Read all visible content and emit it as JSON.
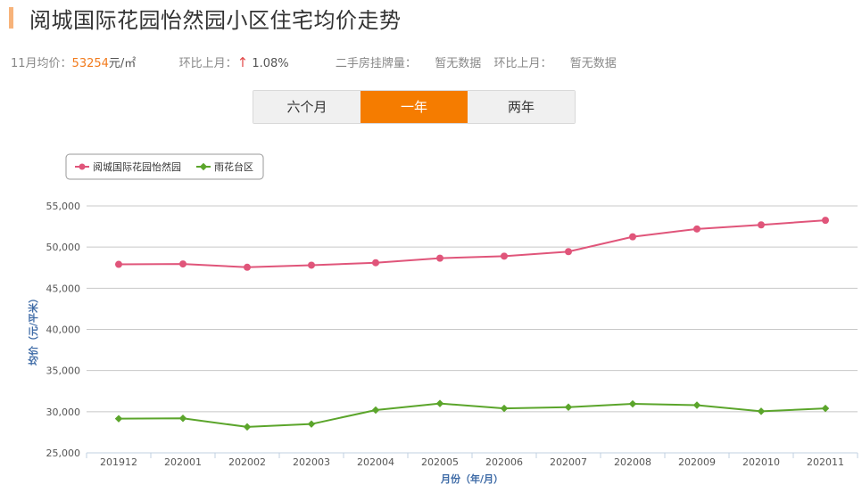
{
  "header": {
    "title": "阅城国际花园怡然园小区住宅均价走势"
  },
  "stats": {
    "avg_label": "11月均价：",
    "avg_value": "53254",
    "avg_unit": "元/㎡",
    "mom_label": "环比上月：",
    "mom_arrow": "↑",
    "mom_value": "1.08%",
    "listing_label": "二手房挂牌量：",
    "listing_value": "暂无数据",
    "listing_mom_label": "环比上月：",
    "listing_mom_value": "暂无数据"
  },
  "tabs": [
    {
      "label": "六个月",
      "active": false
    },
    {
      "label": "一年",
      "active": true
    },
    {
      "label": "两年",
      "active": false
    }
  ],
  "colors": {
    "series_1": "#e0557a",
    "series_2": "#5ba52b",
    "accent": "#f57c00"
  },
  "chart_data": {
    "type": "line",
    "categories": [
      "201912",
      "202001",
      "202002",
      "202003",
      "202004",
      "202005",
      "202006",
      "202007",
      "202008",
      "202009",
      "202010",
      "202011"
    ],
    "series": [
      {
        "name": "阅城国际花园怡然园",
        "values": [
          47900,
          47950,
          47550,
          47800,
          48100,
          48650,
          48900,
          49450,
          51250,
          52200,
          52700,
          53254
        ]
      },
      {
        "name": "雨花台区",
        "values": [
          29150,
          29200,
          28150,
          28500,
          30200,
          31000,
          30400,
          30550,
          30950,
          30800,
          30050,
          30400
        ]
      }
    ],
    "yticks": [
      "25,000",
      "30,000",
      "35,000",
      "40,000",
      "45,000",
      "50,000",
      "55,000"
    ],
    "ylim": [
      25000,
      55000
    ],
    "xlabel": "月份（年/月）",
    "ylabel": "均价（元/平米）",
    "grid": true,
    "legend": "top-left"
  }
}
